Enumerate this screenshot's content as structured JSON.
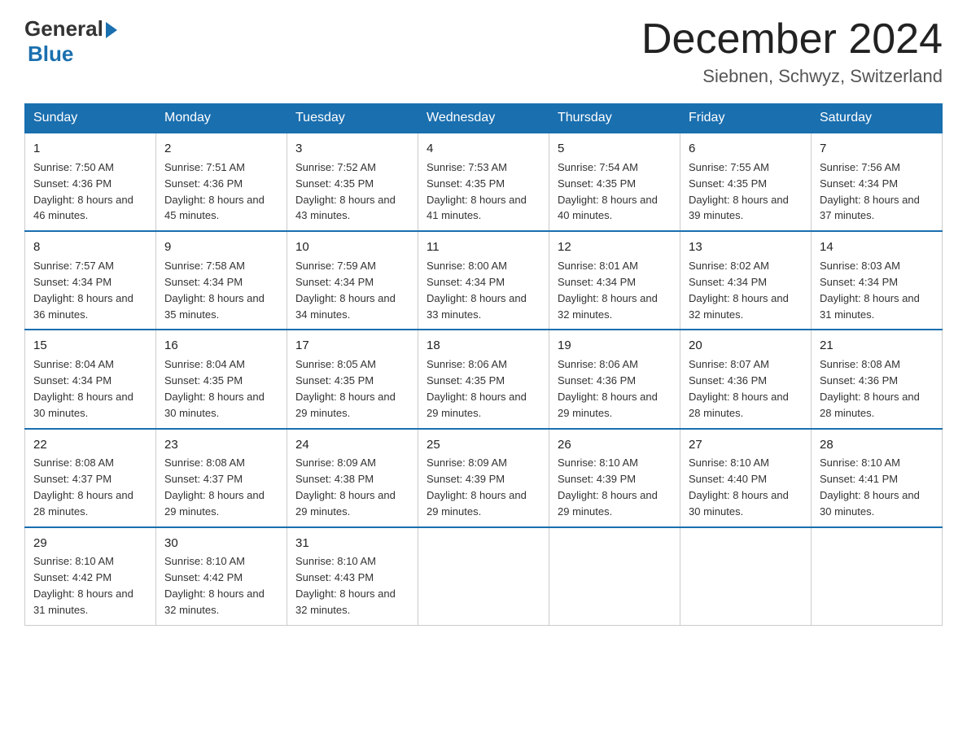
{
  "logo": {
    "general": "General",
    "blue": "Blue"
  },
  "title": "December 2024",
  "location": "Siebnen, Schwyz, Switzerland",
  "days_of_week": [
    "Sunday",
    "Monday",
    "Tuesday",
    "Wednesday",
    "Thursday",
    "Friday",
    "Saturday"
  ],
  "weeks": [
    [
      {
        "day": "1",
        "sunrise": "7:50 AM",
        "sunset": "4:36 PM",
        "daylight": "8 hours and 46 minutes."
      },
      {
        "day": "2",
        "sunrise": "7:51 AM",
        "sunset": "4:36 PM",
        "daylight": "8 hours and 45 minutes."
      },
      {
        "day": "3",
        "sunrise": "7:52 AM",
        "sunset": "4:35 PM",
        "daylight": "8 hours and 43 minutes."
      },
      {
        "day": "4",
        "sunrise": "7:53 AM",
        "sunset": "4:35 PM",
        "daylight": "8 hours and 41 minutes."
      },
      {
        "day": "5",
        "sunrise": "7:54 AM",
        "sunset": "4:35 PM",
        "daylight": "8 hours and 40 minutes."
      },
      {
        "day": "6",
        "sunrise": "7:55 AM",
        "sunset": "4:35 PM",
        "daylight": "8 hours and 39 minutes."
      },
      {
        "day": "7",
        "sunrise": "7:56 AM",
        "sunset": "4:34 PM",
        "daylight": "8 hours and 37 minutes."
      }
    ],
    [
      {
        "day": "8",
        "sunrise": "7:57 AM",
        "sunset": "4:34 PM",
        "daylight": "8 hours and 36 minutes."
      },
      {
        "day": "9",
        "sunrise": "7:58 AM",
        "sunset": "4:34 PM",
        "daylight": "8 hours and 35 minutes."
      },
      {
        "day": "10",
        "sunrise": "7:59 AM",
        "sunset": "4:34 PM",
        "daylight": "8 hours and 34 minutes."
      },
      {
        "day": "11",
        "sunrise": "8:00 AM",
        "sunset": "4:34 PM",
        "daylight": "8 hours and 33 minutes."
      },
      {
        "day": "12",
        "sunrise": "8:01 AM",
        "sunset": "4:34 PM",
        "daylight": "8 hours and 32 minutes."
      },
      {
        "day": "13",
        "sunrise": "8:02 AM",
        "sunset": "4:34 PM",
        "daylight": "8 hours and 32 minutes."
      },
      {
        "day": "14",
        "sunrise": "8:03 AM",
        "sunset": "4:34 PM",
        "daylight": "8 hours and 31 minutes."
      }
    ],
    [
      {
        "day": "15",
        "sunrise": "8:04 AM",
        "sunset": "4:34 PM",
        "daylight": "8 hours and 30 minutes."
      },
      {
        "day": "16",
        "sunrise": "8:04 AM",
        "sunset": "4:35 PM",
        "daylight": "8 hours and 30 minutes."
      },
      {
        "day": "17",
        "sunrise": "8:05 AM",
        "sunset": "4:35 PM",
        "daylight": "8 hours and 29 minutes."
      },
      {
        "day": "18",
        "sunrise": "8:06 AM",
        "sunset": "4:35 PM",
        "daylight": "8 hours and 29 minutes."
      },
      {
        "day": "19",
        "sunrise": "8:06 AM",
        "sunset": "4:36 PM",
        "daylight": "8 hours and 29 minutes."
      },
      {
        "day": "20",
        "sunrise": "8:07 AM",
        "sunset": "4:36 PM",
        "daylight": "8 hours and 28 minutes."
      },
      {
        "day": "21",
        "sunrise": "8:08 AM",
        "sunset": "4:36 PM",
        "daylight": "8 hours and 28 minutes."
      }
    ],
    [
      {
        "day": "22",
        "sunrise": "8:08 AM",
        "sunset": "4:37 PM",
        "daylight": "8 hours and 28 minutes."
      },
      {
        "day": "23",
        "sunrise": "8:08 AM",
        "sunset": "4:37 PM",
        "daylight": "8 hours and 29 minutes."
      },
      {
        "day": "24",
        "sunrise": "8:09 AM",
        "sunset": "4:38 PM",
        "daylight": "8 hours and 29 minutes."
      },
      {
        "day": "25",
        "sunrise": "8:09 AM",
        "sunset": "4:39 PM",
        "daylight": "8 hours and 29 minutes."
      },
      {
        "day": "26",
        "sunrise": "8:10 AM",
        "sunset": "4:39 PM",
        "daylight": "8 hours and 29 minutes."
      },
      {
        "day": "27",
        "sunrise": "8:10 AM",
        "sunset": "4:40 PM",
        "daylight": "8 hours and 30 minutes."
      },
      {
        "day": "28",
        "sunrise": "8:10 AM",
        "sunset": "4:41 PM",
        "daylight": "8 hours and 30 minutes."
      }
    ],
    [
      {
        "day": "29",
        "sunrise": "8:10 AM",
        "sunset": "4:42 PM",
        "daylight": "8 hours and 31 minutes."
      },
      {
        "day": "30",
        "sunrise": "8:10 AM",
        "sunset": "4:42 PM",
        "daylight": "8 hours and 32 minutes."
      },
      {
        "day": "31",
        "sunrise": "8:10 AM",
        "sunset": "4:43 PM",
        "daylight": "8 hours and 32 minutes."
      },
      null,
      null,
      null,
      null
    ]
  ]
}
